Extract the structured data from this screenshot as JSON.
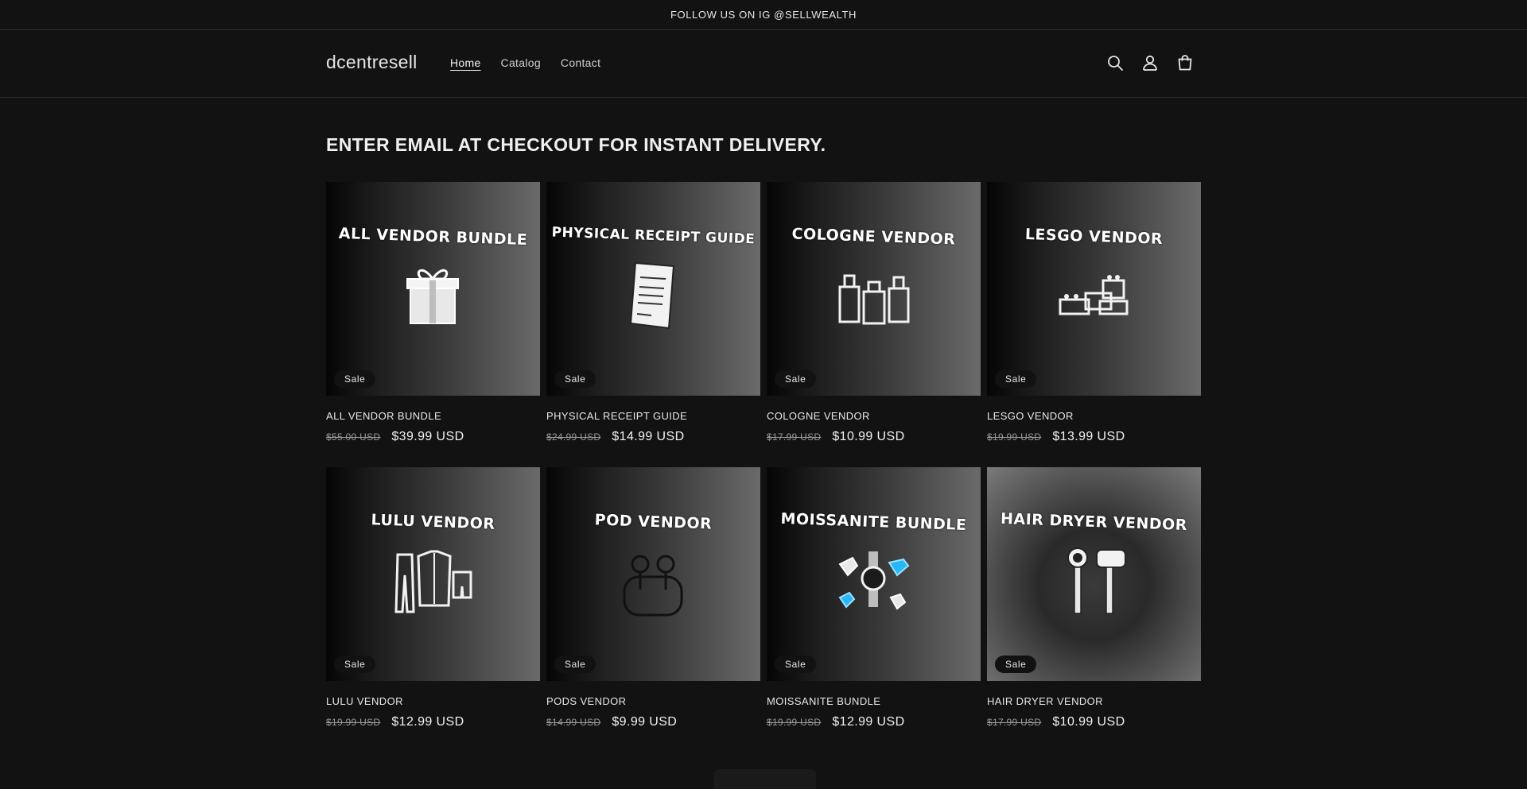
{
  "announcement": "FOLLOW US ON IG @SELLWEALTH",
  "header": {
    "logo": "dcentresell",
    "nav": [
      "Home",
      "Catalog",
      "Contact"
    ],
    "icons": [
      "search-icon",
      "account-icon",
      "cart-icon"
    ]
  },
  "headline": "ENTER EMAIL AT CHECKOUT FOR INSTANT DELIVERY.",
  "products": [
    {
      "image_text": "ALL VENDOR BUNDLE",
      "icon": "gift-box-icon",
      "badge": "Sale",
      "title": "ALL VENDOR BUNDLE",
      "old_price": "$55.00 USD",
      "price": "$39.99 USD"
    },
    {
      "image_text": "PHYSICAL RECEIPT GUIDE",
      "icon": "receipt-icon",
      "badge": "Sale",
      "title": "PHYSICAL RECEIPT GUIDE",
      "old_price": "$24.99 USD",
      "price": "$14.99 USD"
    },
    {
      "image_text": "COLOGNE VENDOR",
      "icon": "cologne-bottles-icon",
      "badge": "Sale",
      "title": "COLOGNE VENDOR",
      "old_price": "$17.99 USD",
      "price": "$10.99 USD"
    },
    {
      "image_text": "LESGO VENDOR",
      "icon": "lego-bricks-icon",
      "badge": "Sale",
      "title": "LESGO VENDOR",
      "old_price": "$19.99 USD",
      "price": "$13.99 USD"
    },
    {
      "image_text": "LULU VENDOR",
      "icon": "clothing-icon",
      "badge": "Sale",
      "title": "LULU VENDOR",
      "old_price": "$19.99 USD",
      "price": "$12.99 USD"
    },
    {
      "image_text": "POD VENDOR",
      "icon": "earbuds-icon",
      "badge": "Sale",
      "title": "PODS VENDOR",
      "old_price": "$14.99 USD",
      "price": "$9.99 USD"
    },
    {
      "image_text": "MOISSANITE BUNDLE",
      "icon": "diamond-watch-icon",
      "badge": "Sale",
      "title": "MOISSANITE BUNDLE",
      "old_price": "$19.99 USD",
      "price": "$12.99 USD"
    },
    {
      "image_text": "HAIR DRYER VENDOR",
      "icon": "hair-dryer-icon",
      "badge": "Sale",
      "title": "HAIR DRYER VENDOR",
      "old_price": "$17.99 USD",
      "price": "$10.99 USD"
    }
  ],
  "colors": {
    "background": "#121212",
    "text": "#f2f2f2",
    "accent_diamond": "#29b6f6"
  }
}
